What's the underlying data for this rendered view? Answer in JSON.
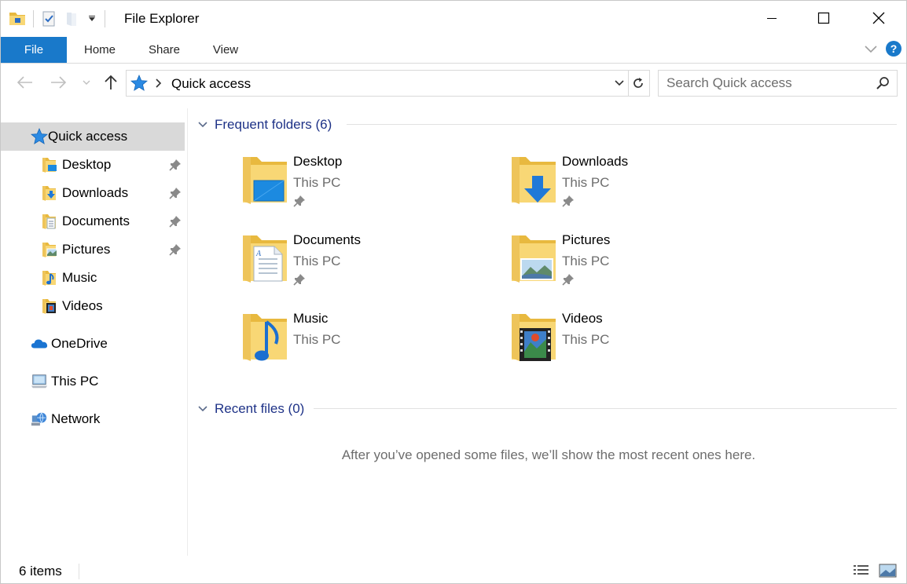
{
  "window": {
    "title": "File Explorer",
    "controls": [
      "minimize",
      "maximize",
      "close"
    ]
  },
  "ribbon": {
    "tabs": [
      {
        "label": "File",
        "active": true
      },
      {
        "label": "Home"
      },
      {
        "label": "Share"
      },
      {
        "label": "View"
      }
    ],
    "help_label": "?"
  },
  "navigation": {
    "breadcrumb": "Quick access",
    "search_placeholder": "Search Quick access"
  },
  "sidebar": {
    "quick_access": "Quick access",
    "pinned": [
      {
        "label": "Desktop",
        "icon": "desktop-folder-icon",
        "pinned": true
      },
      {
        "label": "Downloads",
        "icon": "downloads-folder-icon",
        "pinned": true
      },
      {
        "label": "Documents",
        "icon": "documents-folder-icon",
        "pinned": true
      },
      {
        "label": "Pictures",
        "icon": "pictures-folder-icon",
        "pinned": true
      },
      {
        "label": "Music",
        "icon": "music-folder-icon",
        "pinned": false
      },
      {
        "label": "Videos",
        "icon": "videos-folder-icon",
        "pinned": false
      }
    ],
    "onedrive": "OneDrive",
    "this_pc": "This PC",
    "network": "Network"
  },
  "content": {
    "frequent_header": "Frequent folders (6)",
    "folders": [
      {
        "name": "Desktop",
        "location": "This PC",
        "pinned": true
      },
      {
        "name": "Downloads",
        "location": "This PC",
        "pinned": true
      },
      {
        "name": "Documents",
        "location": "This PC",
        "pinned": true
      },
      {
        "name": "Pictures",
        "location": "This PC",
        "pinned": true
      },
      {
        "name": "Music",
        "location": "This PC",
        "pinned": false
      },
      {
        "name": "Videos",
        "location": "This PC",
        "pinned": false
      }
    ],
    "recent_header": "Recent files (0)",
    "recent_empty": "After you’ve opened some files, we’ll show the most recent ones here."
  },
  "status": {
    "item_count": "6 items"
  },
  "colors": {
    "accent": "#1979ca",
    "header_text": "#1e3287",
    "selection": "#d9d9d9",
    "folder": "#f8d775",
    "muted_text": "#6d6d6d"
  }
}
